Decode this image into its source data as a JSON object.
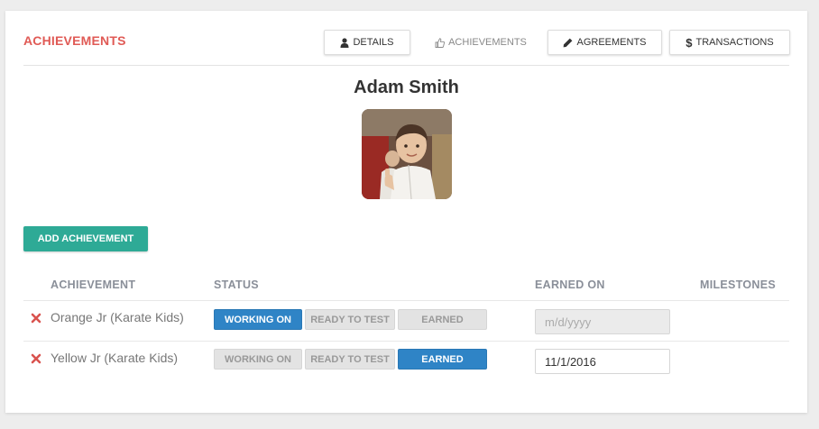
{
  "panel": {
    "title": "ACHIEVEMENTS"
  },
  "nav": {
    "details": "DETAILS",
    "achievements": "ACHIEVEMENTS",
    "agreements": "AGREEMENTS",
    "transactions": "TRANSACTIONS",
    "active_tab": "achievements"
  },
  "student": {
    "name": "Adam Smith"
  },
  "actions": {
    "add_achievement": "ADD ACHIEVEMENT"
  },
  "table": {
    "headers": {
      "achievement": "ACHIEVEMENT",
      "status": "STATUS",
      "earned_on": "EARNED ON",
      "milestones": "MILESTONES"
    },
    "status_options": {
      "working_on": "WORKING ON",
      "ready_to_test": "READY TO TEST",
      "earned": "EARNED"
    },
    "rows": [
      {
        "name": "Orange Jr (Karate Kids)",
        "status": "working_on",
        "earned_on_value": "",
        "earned_on_placeholder": "m/d/yyyy"
      },
      {
        "name": "Yellow Jr (Karate Kids)",
        "status": "earned",
        "earned_on_value": "11/1/2016",
        "earned_on_placeholder": "m/d/yyyy"
      }
    ]
  },
  "colors": {
    "title_red": "#e05a55",
    "primary_teal": "#2eaa96",
    "status_active_blue": "#2f84c6",
    "delete_red": "#d9534f"
  }
}
